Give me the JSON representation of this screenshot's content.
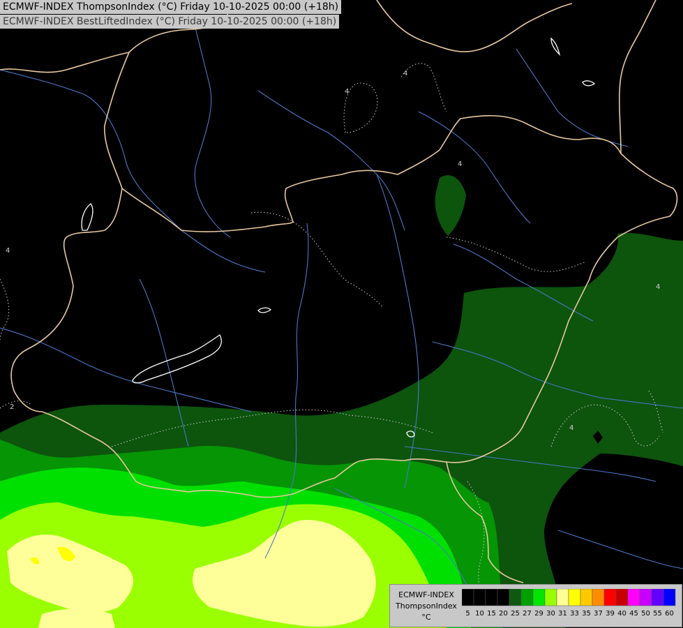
{
  "header": {
    "line1": "ECMWF-INDEX ThompsonIndex (°C) Friday 10-10-2025 00:00 (+18h)",
    "line2": "ECMWF-INDEX BestLiftedIndex (°C) Friday 10-10-2025 00:00 (+18h)"
  },
  "legend": {
    "model": "ECMWF-INDEX",
    "variable": "ThompsonIndex",
    "unit": "°C",
    "bins": [
      {
        "label": "5",
        "color": "#000000"
      },
      {
        "label": "10",
        "color": "#000000"
      },
      {
        "label": "15",
        "color": "#000000"
      },
      {
        "label": "20",
        "color": "#000000"
      },
      {
        "label": "25",
        "color": "#105810"
      },
      {
        "label": "27",
        "color": "#00a000"
      },
      {
        "label": "29",
        "color": "#00e600"
      },
      {
        "label": "30",
        "color": "#96ff00"
      },
      {
        "label": "31",
        "color": "#ffff96"
      },
      {
        "label": "33",
        "color": "#ffff00"
      },
      {
        "label": "35",
        "color": "#ffc800"
      },
      {
        "label": "37",
        "color": "#ff8c00"
      },
      {
        "label": "39",
        "color": "#ff0000"
      },
      {
        "label": "40",
        "color": "#c80000"
      },
      {
        "label": "45",
        "color": "#ff00ff"
      },
      {
        "label": "50",
        "color": "#c800ff"
      },
      {
        "label": "55",
        "color": "#6400ff"
      },
      {
        "label": "60",
        "color": "#0000ff"
      }
    ]
  },
  "map": {
    "fill_colors": {
      "band_25": "#0d540d",
      "band_27": "#059505",
      "band_29": "#00e000",
      "band_30": "#9aff00",
      "band_31": "#ffff99",
      "band_33": "#ffff00"
    },
    "border_color": "#e8c8a0",
    "river_color": "#4a78c8",
    "lake_color": "#ffffff",
    "contour_color": "#d0d0d0",
    "contour_labels": [
      "4",
      "4",
      "4",
      "4",
      "4",
      "2",
      "4"
    ]
  }
}
